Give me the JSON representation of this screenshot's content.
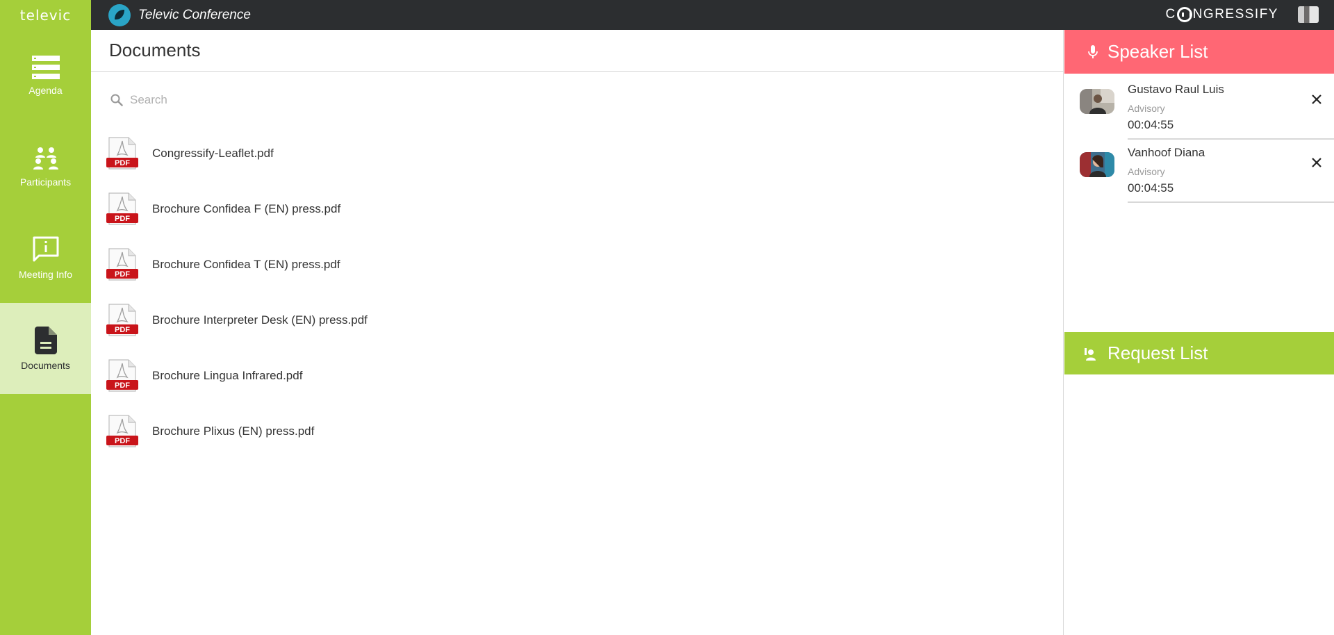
{
  "topbar": {
    "brand": "televic",
    "app_title": "Televic Conference",
    "product_prefix": "C",
    "product_suffix": "NGRESSIFY"
  },
  "nav": {
    "items": [
      {
        "label": "Agenda",
        "icon": "agenda-icon"
      },
      {
        "label": "Participants",
        "icon": "participants-icon"
      },
      {
        "label": "Meeting Info",
        "icon": "info-icon"
      },
      {
        "label": "Documents",
        "icon": "document-icon",
        "active": true
      }
    ]
  },
  "main": {
    "title": "Documents",
    "search": {
      "placeholder": "Search",
      "value": ""
    },
    "documents": [
      {
        "name": "Congressify-Leaflet.pdf",
        "icon": "pdf-icon"
      },
      {
        "name": "Brochure Confidea F (EN) press.pdf",
        "icon": "pdf-icon"
      },
      {
        "name": "Brochure Confidea T (EN) press.pdf",
        "icon": "pdf-icon"
      },
      {
        "name": "Brochure Interpreter Desk (EN) press.pdf",
        "icon": "pdf-icon"
      },
      {
        "name": "Brochure Lingua Infrared.pdf",
        "icon": "pdf-icon"
      },
      {
        "name": "Brochure Plixus (EN) press.pdf",
        "icon": "pdf-icon"
      }
    ],
    "pdf_badge": "PDF"
  },
  "speaker_list": {
    "title": "Speaker List",
    "speakers": [
      {
        "name": "Gustavo Raul Luis",
        "group": "Advisory",
        "time": "00:04:55"
      },
      {
        "name": "Vanhoof Diana",
        "group": "Advisory",
        "time": "00:04:55"
      }
    ]
  },
  "request_list": {
    "title": "Request List"
  },
  "colors": {
    "brand_green": "#a5cf3a",
    "topbar": "#2c2e30",
    "speaker_red": "#ff6774",
    "active_nav": "#ddeebb"
  }
}
